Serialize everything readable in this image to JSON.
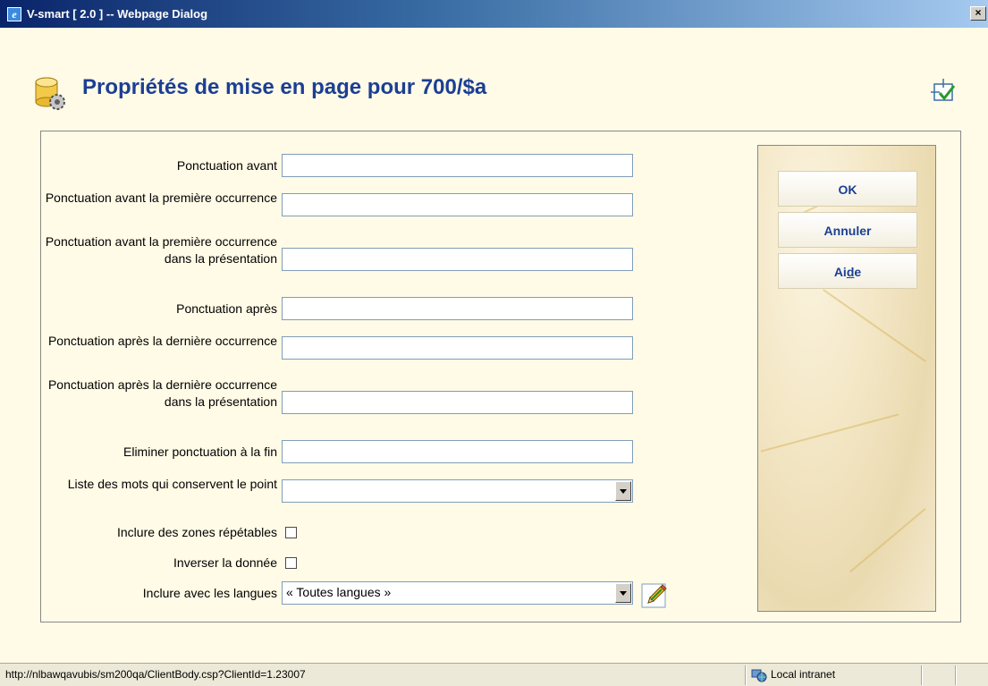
{
  "window": {
    "title": "V-smart [ 2.0 ] -- Webpage Dialog",
    "close_glyph": "×",
    "app_icon": "ie-icon"
  },
  "header": {
    "title": "Propriétés de mise en page pour 700/$a",
    "icon": "database-gear-icon",
    "tool_icon": "layout-check-icon"
  },
  "form": {
    "fields": [
      {
        "label": "Ponctuation avant",
        "value": ""
      },
      {
        "label": "Ponctuation avant la première occurrence",
        "value": ""
      },
      {
        "label": "Ponctuation avant la première occurrence dans la présentation",
        "value": ""
      },
      {
        "label": "Ponctuation après",
        "value": ""
      },
      {
        "label": "Ponctuation après la dernière occurrence",
        "value": ""
      },
      {
        "label": "Ponctuation après la dernière occurrence dans la présentation",
        "value": ""
      },
      {
        "label": "Eliminer ponctuation à la fin",
        "value": ""
      }
    ],
    "word_list": {
      "label": "Liste des mots qui conservent le point",
      "value": ""
    },
    "checkboxes": [
      {
        "label": "Inclure des zones répétables",
        "checked": false
      },
      {
        "label": "Inverser la donnée",
        "checked": false
      }
    ],
    "languages": {
      "label": "Inclure avec les langues",
      "value": "« Toutes langues »",
      "edit_icon": "pencil-icon"
    }
  },
  "buttons": {
    "ok": "OK",
    "cancel": "Annuler",
    "help_pre": "Ai",
    "help_u": "d",
    "help_post": "e"
  },
  "statusbar": {
    "url": "http://nlbawqavubis/sm200qa/ClientBody.csp?ClientId=1.23007",
    "zone": "Local intranet"
  }
}
